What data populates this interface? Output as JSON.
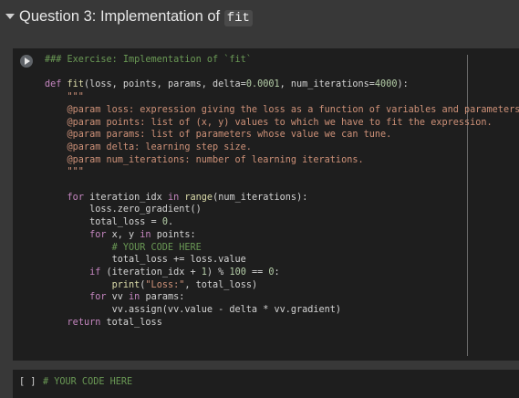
{
  "header": {
    "title_prefix": "Question 3: Implementation of ",
    "title_code": "fit"
  },
  "cell1": {
    "lines": [
      "### Exercise: Implementation of `fit`",
      "",
      "def fit(loss, points, params, delta=0.0001, num_iterations=4000):",
      "    \"\"\"",
      "    @param loss: expression giving the loss as a function of variables and parameters.",
      "    @param points: list of (x, y) values to which we have to fit the expression.",
      "    @param params: list of parameters whose value we can tune.",
      "    @param delta: learning step size.",
      "    @param num_iterations: number of learning iterations.",
      "    \"\"\"",
      "",
      "    for iteration_idx in range(num_iterations):",
      "        loss.zero_gradient()",
      "        total_loss = 0.",
      "        for x, y in points:",
      "            # YOUR CODE HERE",
      "            total_loss += loss.value",
      "        if (iteration_idx + 1) % 100 == 0:",
      "            print(\"Loss:\", total_loss)",
      "        for vv in params:",
      "            vv.assign(vv.value - delta * vv.gradient)",
      "    return total_loss"
    ]
  },
  "cell2": {
    "prompt": "[ ]",
    "code": "# YOUR CODE HERE"
  },
  "colors": {
    "background": "#383838",
    "cell_background": "#1e1e1e",
    "comment": "#6a9955",
    "keyword": "#569cd6",
    "string": "#ce9178",
    "number": "#b5cea8"
  }
}
